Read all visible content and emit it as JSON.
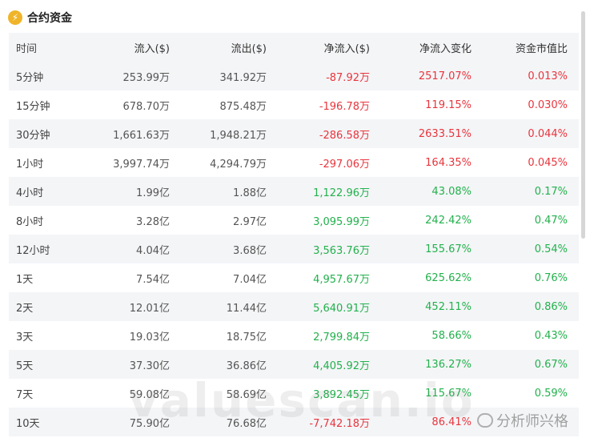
{
  "header": {
    "title": "合约资金",
    "icon": "coin-icon"
  },
  "table": {
    "columns": [
      "时间",
      "流入($)",
      "流出($)",
      "净流入($)",
      "净流入变化",
      "资金市值比"
    ],
    "rows": [
      {
        "time": "5分钟",
        "inflow": "253.99万",
        "outflow": "341.92万",
        "net": "-87.92万",
        "change": "2517.07%",
        "ratio": "0.013%",
        "dir": "neg"
      },
      {
        "time": "15分钟",
        "inflow": "678.70万",
        "outflow": "875.48万",
        "net": "-196.78万",
        "change": "119.15%",
        "ratio": "0.030%",
        "dir": "neg"
      },
      {
        "time": "30分钟",
        "inflow": "1,661.63万",
        "outflow": "1,948.21万",
        "net": "-286.58万",
        "change": "2633.51%",
        "ratio": "0.044%",
        "dir": "neg"
      },
      {
        "time": "1小时",
        "inflow": "3,997.74万",
        "outflow": "4,294.79万",
        "net": "-297.06万",
        "change": "164.35%",
        "ratio": "0.045%",
        "dir": "neg"
      },
      {
        "time": "4小时",
        "inflow": "1.99亿",
        "outflow": "1.88亿",
        "net": "1,122.96万",
        "change": "43.08%",
        "ratio": "0.17%",
        "dir": "pos"
      },
      {
        "time": "8小时",
        "inflow": "3.28亿",
        "outflow": "2.97亿",
        "net": "3,095.99万",
        "change": "242.42%",
        "ratio": "0.47%",
        "dir": "pos"
      },
      {
        "time": "12小时",
        "inflow": "4.04亿",
        "outflow": "3.68亿",
        "net": "3,563.76万",
        "change": "155.67%",
        "ratio": "0.54%",
        "dir": "pos"
      },
      {
        "time": "1天",
        "inflow": "7.54亿",
        "outflow": "7.04亿",
        "net": "4,957.67万",
        "change": "625.62%",
        "ratio": "0.76%",
        "dir": "pos"
      },
      {
        "time": "2天",
        "inflow": "12.01亿",
        "outflow": "11.44亿",
        "net": "5,640.91万",
        "change": "452.11%",
        "ratio": "0.86%",
        "dir": "pos"
      },
      {
        "time": "3天",
        "inflow": "19.03亿",
        "outflow": "18.75亿",
        "net": "2,799.84万",
        "change": "58.66%",
        "ratio": "0.43%",
        "dir": "pos"
      },
      {
        "time": "5天",
        "inflow": "37.30亿",
        "outflow": "36.86亿",
        "net": "4,405.92万",
        "change": "136.27%",
        "ratio": "0.67%",
        "dir": "pos"
      },
      {
        "time": "7天",
        "inflow": "59.08亿",
        "outflow": "58.69亿",
        "net": "3,892.45万",
        "change": "115.67%",
        "ratio": "0.59%",
        "dir": "pos"
      },
      {
        "time": "10天",
        "inflow": "75.90亿",
        "outflow": "76.68亿",
        "net": "-7,742.18万",
        "change": "86.41%",
        "ratio": "",
        "dir": "neg"
      }
    ]
  },
  "colors": {
    "negative": "#e8353d",
    "positive": "#22b14c",
    "stripe": "#f4f5f7"
  },
  "watermark": {
    "text": "valuescan.io",
    "badge": "分析师兴格"
  }
}
